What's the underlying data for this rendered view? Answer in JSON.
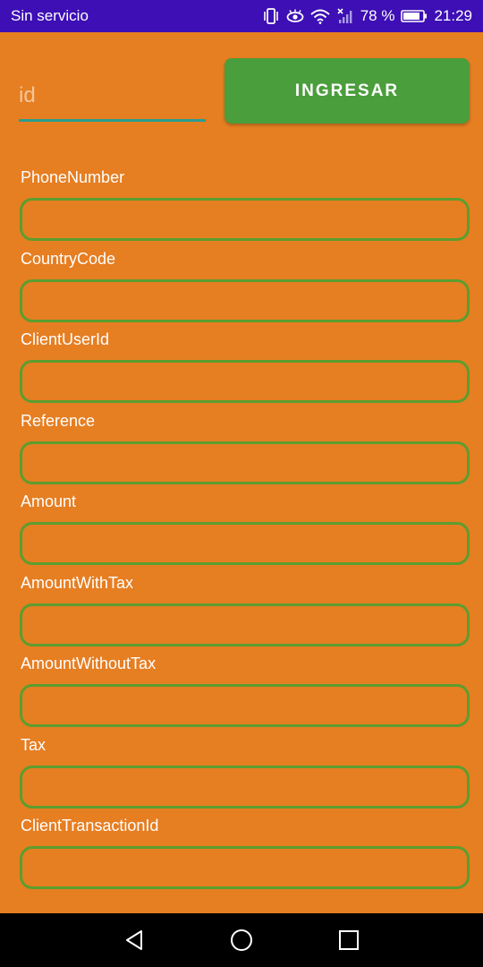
{
  "status_bar": {
    "carrier": "Sin servicio",
    "battery": "78 %",
    "time": "21:29",
    "icons": [
      "vibrate-icon",
      "eye-comfort-icon",
      "wifi-icon",
      "no-signal-icon",
      "battery-icon"
    ]
  },
  "header": {
    "id_placeholder": "id",
    "submit_label": "INGRESAR"
  },
  "form": {
    "fields": [
      {
        "label": "PhoneNumber",
        "value": ""
      },
      {
        "label": "CountryCode",
        "value": ""
      },
      {
        "label": "ClientUserId",
        "value": ""
      },
      {
        "label": "Reference",
        "value": ""
      },
      {
        "label": "Amount",
        "value": ""
      },
      {
        "label": "AmountWithTax",
        "value": ""
      },
      {
        "label": "AmountWithoutTax",
        "value": ""
      },
      {
        "label": "Tax",
        "value": ""
      },
      {
        "label": "ClientTransactionId",
        "value": ""
      }
    ]
  },
  "nav_bar": {
    "buttons": [
      "back-icon",
      "home-icon",
      "recents-icon"
    ]
  },
  "colors": {
    "background": "#e67e22",
    "status_bar": "#3d0fb5",
    "button": "#4a9e3b",
    "input_border": "#5b9e2f",
    "underline": "#2a9d8f"
  }
}
